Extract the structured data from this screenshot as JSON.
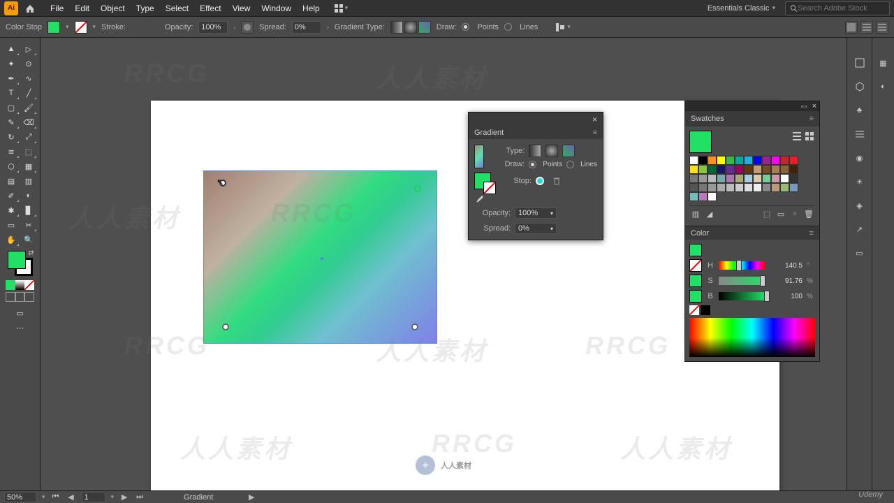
{
  "menu": {
    "items": [
      "File",
      "Edit",
      "Object",
      "Type",
      "Select",
      "Effect",
      "View",
      "Window",
      "Help"
    ]
  },
  "workspace_selector": "Essentials Classic",
  "search": {
    "placeholder": "Search Adobe Stock"
  },
  "control": {
    "label": "Color Stop",
    "fill_color": "#22e066",
    "stroke_label": "Stroke:",
    "opacity_label": "Opacity:",
    "opacity_value": "100%",
    "spread_label": "Spread:",
    "spread_value": "0%",
    "gt_label": "Gradient Type:",
    "draw_label": "Draw:",
    "draw_points": "Points",
    "draw_lines": "Lines"
  },
  "gradient_panel": {
    "title": "Gradient",
    "type_label": "Type:",
    "draw_label": "Draw:",
    "draw_points": "Points",
    "draw_lines": "Lines",
    "stop_label": "Stop:",
    "opacity_label": "Opacity:",
    "opacity_value": "100%",
    "spread_label": "Spread:",
    "spread_value": "0%"
  },
  "swatches": {
    "title": "Swatches",
    "colors_row1": [
      "#ffffff",
      "#000000",
      "#f7931e",
      "#ffff00",
      "#39b54a",
      "#00a99d",
      "#29abe2",
      "#0000ff",
      "#93278f",
      "#ff00ff",
      "#c1272d",
      "#ed1c24"
    ],
    "colors_row2": [
      "#f7e01e",
      "#8cc63f",
      "#006837",
      "#1b1464",
      "#662d91",
      "#9e005d",
      "#603813",
      "#c69c6d",
      "#754c24",
      "#a67c52",
      "#8c6239",
      "#42210b"
    ],
    "colors_row3": [
      "#777",
      "#999",
      "#bbb",
      "#7aa",
      "#a7a",
      "#aa7",
      "#aaccdd",
      "#ddccaa",
      "#77cc99",
      "#cc99aa"
    ],
    "colors_row4": [
      "#fff",
      "#333",
      "#555",
      "#777",
      "#999",
      "#aaa",
      "#bbb",
      "#ccc",
      "#ddd",
      "#eee"
    ],
    "colors_row5": [
      "#888",
      "#b97",
      "#9b7",
      "#79b",
      "#7bb",
      "#b7b",
      "#fff"
    ]
  },
  "color": {
    "title": "Color",
    "h": {
      "label": "H",
      "value": "140.5",
      "unit": "°"
    },
    "s": {
      "label": "S",
      "value": "91.76",
      "unit": "%"
    },
    "b": {
      "label": "B",
      "value": "100",
      "unit": "%"
    }
  },
  "statusbar": {
    "zoom": "50%",
    "artboard_num": "1",
    "tool": "Gradient"
  },
  "watermark_text": "人人素材",
  "watermark_rrcg": "RRCG",
  "udemy": "Udemy"
}
